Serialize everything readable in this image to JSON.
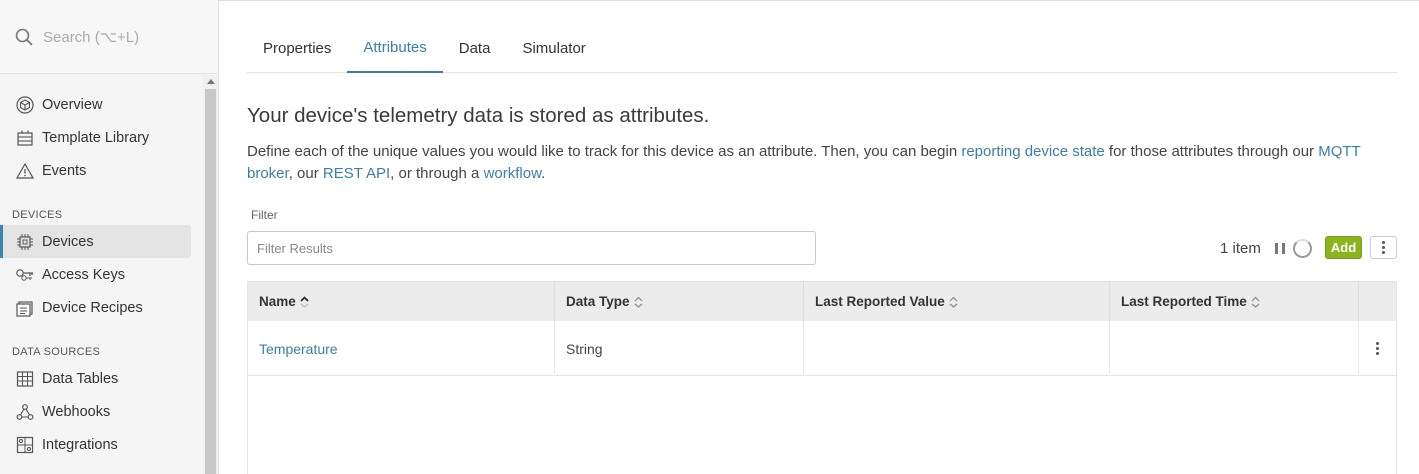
{
  "sidebar": {
    "search_placeholder": "Search (⌥+L)",
    "items_top": [
      {
        "label": "Overview",
        "icon": "cube-icon"
      },
      {
        "label": "Template Library",
        "icon": "template-library-icon"
      },
      {
        "label": "Events",
        "icon": "warning-icon"
      }
    ],
    "section_devices": "DEVICES",
    "items_devices": [
      {
        "label": "Devices",
        "icon": "chip-icon",
        "active": true
      },
      {
        "label": "Access Keys",
        "icon": "key-icon"
      },
      {
        "label": "Device Recipes",
        "icon": "recipe-icon"
      }
    ],
    "section_data_sources": "DATA SOURCES",
    "items_data": [
      {
        "label": "Data Tables",
        "icon": "table-icon"
      },
      {
        "label": "Webhooks",
        "icon": "webhook-icon"
      },
      {
        "label": "Integrations",
        "icon": "integrations-icon"
      }
    ]
  },
  "tabs": [
    {
      "label": "Properties"
    },
    {
      "label": "Attributes",
      "active": true
    },
    {
      "label": "Data"
    },
    {
      "label": "Simulator"
    }
  ],
  "main": {
    "heading": "Your device's telemetry data is stored as attributes.",
    "desc_1": "Define each of the unique values you would like to track for this device as an attribute. Then, you can begin ",
    "link_reporting": "reporting device state",
    "desc_2": " for those attributes through our ",
    "link_mqtt": "MQTT broker",
    "desc_3": ", our ",
    "link_rest": "REST API",
    "desc_4": ", or through a ",
    "link_workflow": "workflow",
    "desc_5": ".",
    "filter_label": "Filter",
    "filter_placeholder": "Filter Results",
    "item_count": "1 item",
    "add_label": "Add"
  },
  "table": {
    "columns": [
      "Name",
      "Data Type",
      "Last Reported Value",
      "Last Reported Time"
    ],
    "rows": [
      {
        "name": "Temperature",
        "data_type": "String",
        "last_value": "",
        "last_time": ""
      }
    ]
  },
  "colors": {
    "accent": "#3b7fa8",
    "add_button": "#8bb21f"
  }
}
